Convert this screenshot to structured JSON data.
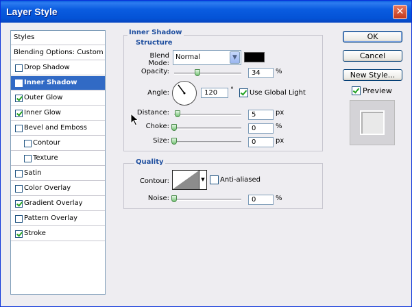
{
  "window": {
    "title": "Layer Style",
    "close_glyph": "✕"
  },
  "styles_panel": {
    "header": "Styles",
    "blending": "Blending Options: Custom",
    "items": [
      {
        "label": "Drop Shadow",
        "checked": false,
        "selected": false,
        "indent": false
      },
      {
        "label": "Inner Shadow",
        "checked": true,
        "selected": true,
        "indent": false
      },
      {
        "label": "Outer Glow",
        "checked": true,
        "selected": false,
        "indent": false
      },
      {
        "label": "Inner Glow",
        "checked": true,
        "selected": false,
        "indent": false
      },
      {
        "label": "Bevel and Emboss",
        "checked": false,
        "selected": false,
        "indent": false
      },
      {
        "label": "Contour",
        "checked": false,
        "selected": false,
        "indent": true
      },
      {
        "label": "Texture",
        "checked": false,
        "selected": false,
        "indent": true
      },
      {
        "label": "Satin",
        "checked": false,
        "selected": false,
        "indent": false
      },
      {
        "label": "Color Overlay",
        "checked": false,
        "selected": false,
        "indent": false
      },
      {
        "label": "Gradient Overlay",
        "checked": true,
        "selected": false,
        "indent": false
      },
      {
        "label": "Pattern Overlay",
        "checked": false,
        "selected": false,
        "indent": false
      },
      {
        "label": "Stroke",
        "checked": true,
        "selected": false,
        "indent": false
      }
    ]
  },
  "inner_shadow": {
    "title": "Inner Shadow",
    "structure_title": "Structure",
    "blend_mode_label": "Blend Mode:",
    "blend_mode_value": "Normal",
    "shadow_color": "#000000",
    "opacity_label": "Opacity:",
    "opacity_value": "34",
    "opacity_unit": "%",
    "angle_label": "Angle:",
    "angle_value": "120",
    "angle_unit": "°",
    "use_global_light_label": "Use Global Light",
    "use_global_light": true,
    "distance_label": "Distance:",
    "distance_value": "5",
    "distance_unit": "px",
    "choke_label": "Choke:",
    "choke_value": "0",
    "choke_unit": "%",
    "size_label": "Size:",
    "size_value": "0",
    "size_unit": "px"
  },
  "quality": {
    "title": "Quality",
    "contour_label": "Contour:",
    "anti_aliased_label": "Anti-aliased",
    "anti_aliased": false,
    "noise_label": "Noise:",
    "noise_value": "0",
    "noise_unit": "%"
  },
  "buttons": {
    "ok": "OK",
    "cancel": "Cancel",
    "new_style": "New Style...",
    "preview_label": "Preview",
    "preview_checked": true
  },
  "colors": {
    "accent": "#316ac5",
    "title_bar": "#0a5ce0",
    "section_title": "#1f4f9f"
  },
  "icons": [
    "close-icon",
    "chevron-down-icon",
    "angle-dial-icon",
    "mouse-cursor-icon"
  ]
}
